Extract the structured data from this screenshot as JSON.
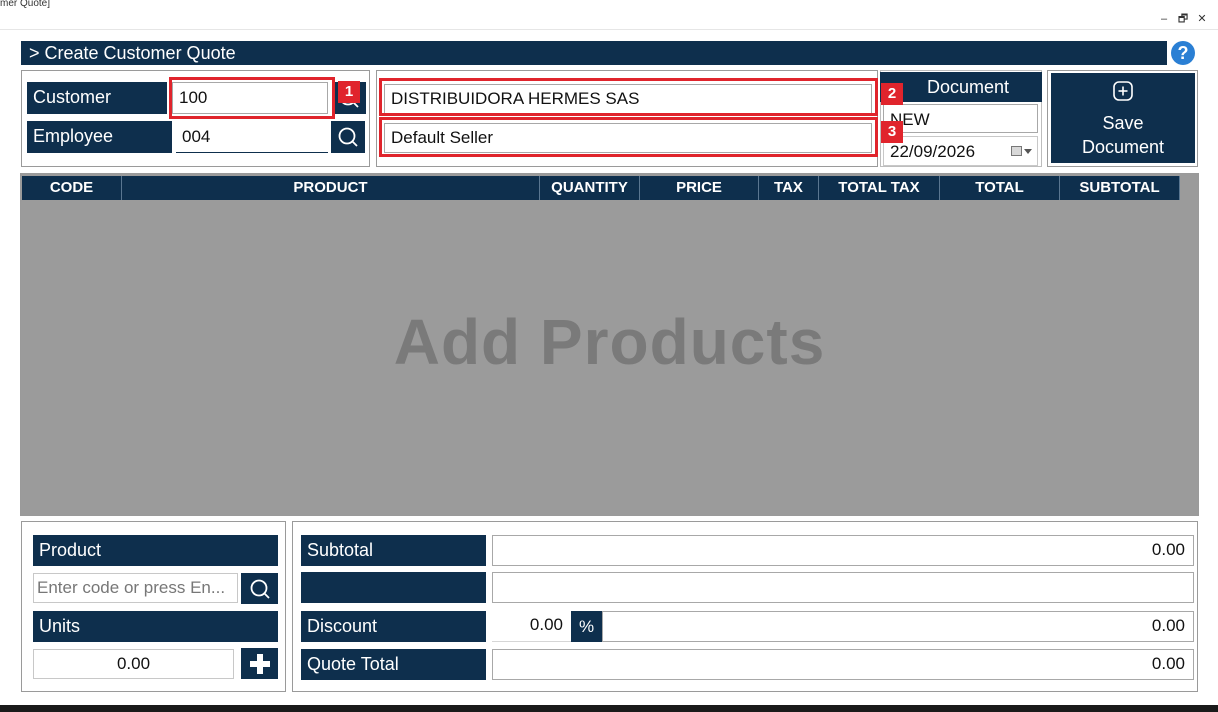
{
  "window": {
    "title_fragment": "mer Quote]",
    "buttons": {
      "minimize": "–",
      "restore": "🗗",
      "close": "✕"
    }
  },
  "header": {
    "title": "> Create Customer Quote",
    "help_label": "?"
  },
  "customer_section": {
    "customer_label": "Customer",
    "customer_value": "100",
    "employee_label": "Employee",
    "employee_value": "004",
    "customer_name": "DISTRIBUIDORA HERMES SAS",
    "seller_name": "Default Seller"
  },
  "document": {
    "label": "Document",
    "number": "NEW",
    "date": "22/09/2026"
  },
  "save_button": {
    "line1": "Save",
    "line2": "Document"
  },
  "annotations": [
    "1",
    "2",
    "3"
  ],
  "table": {
    "columns": [
      "CODE",
      "PRODUCT",
      "QUANTITY",
      "PRICE",
      "TAX",
      "TOTAL TAX",
      "TOTAL",
      "SUBTOTAL"
    ],
    "empty_text": "Add Products"
  },
  "entry": {
    "product_label": "Product",
    "product_placeholder": "Enter code or press En...",
    "units_label": "Units",
    "units_value": "0.00"
  },
  "totals": {
    "subtotal_label": "Subtotal",
    "subtotal_value": "0.00",
    "blank_label": "",
    "blank_value": "",
    "discount_label": "Discount",
    "discount_percent_value": "0.00",
    "discount_percent_symbol": "%",
    "discount_value": "0.00",
    "total_label": "Quote Total",
    "total_value": "0.00"
  },
  "colors": {
    "navy": "#0e2f4d",
    "grid_gray": "#9b9b9b",
    "annotation_red": "#e0242c",
    "help_blue": "#2a7fd4"
  }
}
